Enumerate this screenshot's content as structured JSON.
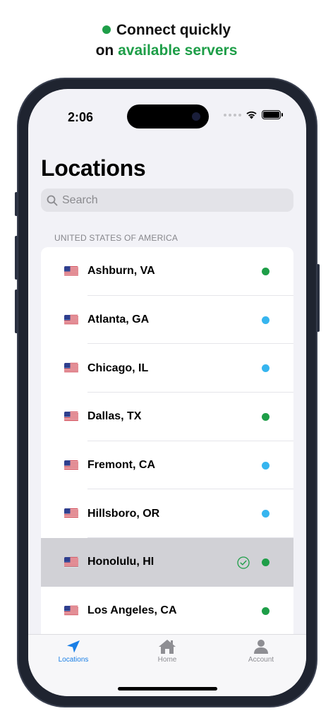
{
  "headline": {
    "line1": "Connect quickly",
    "line2_prefix": "on",
    "line2_accent": "available servers"
  },
  "status_bar": {
    "time": "2:06"
  },
  "page": {
    "title": "Locations",
    "search_placeholder": "Search",
    "section_header": "UNITED STATES OF AMERICA"
  },
  "locations": [
    {
      "name": "Ashburn, VA",
      "status_color": "#1e9e48",
      "selected": false
    },
    {
      "name": "Atlanta, GA",
      "status_color": "#36b5ef",
      "selected": false
    },
    {
      "name": "Chicago, IL",
      "status_color": "#36b5ef",
      "selected": false
    },
    {
      "name": "Dallas, TX",
      "status_color": "#1e9e48",
      "selected": false
    },
    {
      "name": "Fremont, CA",
      "status_color": "#36b5ef",
      "selected": false
    },
    {
      "name": "Hillsboro, OR",
      "status_color": "#36b5ef",
      "selected": false
    },
    {
      "name": "Honolulu, HI",
      "status_color": "#1e9e48",
      "selected": true
    },
    {
      "name": "Los Angeles, CA",
      "status_color": "#1e9e48",
      "selected": false
    }
  ],
  "tabbar": {
    "tabs": [
      {
        "label": "Locations",
        "icon": "location-arrow-icon",
        "active": true
      },
      {
        "label": "Home",
        "icon": "house-icon",
        "active": false
      },
      {
        "label": "Account",
        "icon": "person-icon",
        "active": false
      }
    ]
  },
  "colors": {
    "accent": "#1e9e48",
    "tab_active": "#1a7fe6",
    "tab_inactive": "#8e8e93",
    "available": "#1e9e48",
    "busy": "#36b5ef"
  }
}
